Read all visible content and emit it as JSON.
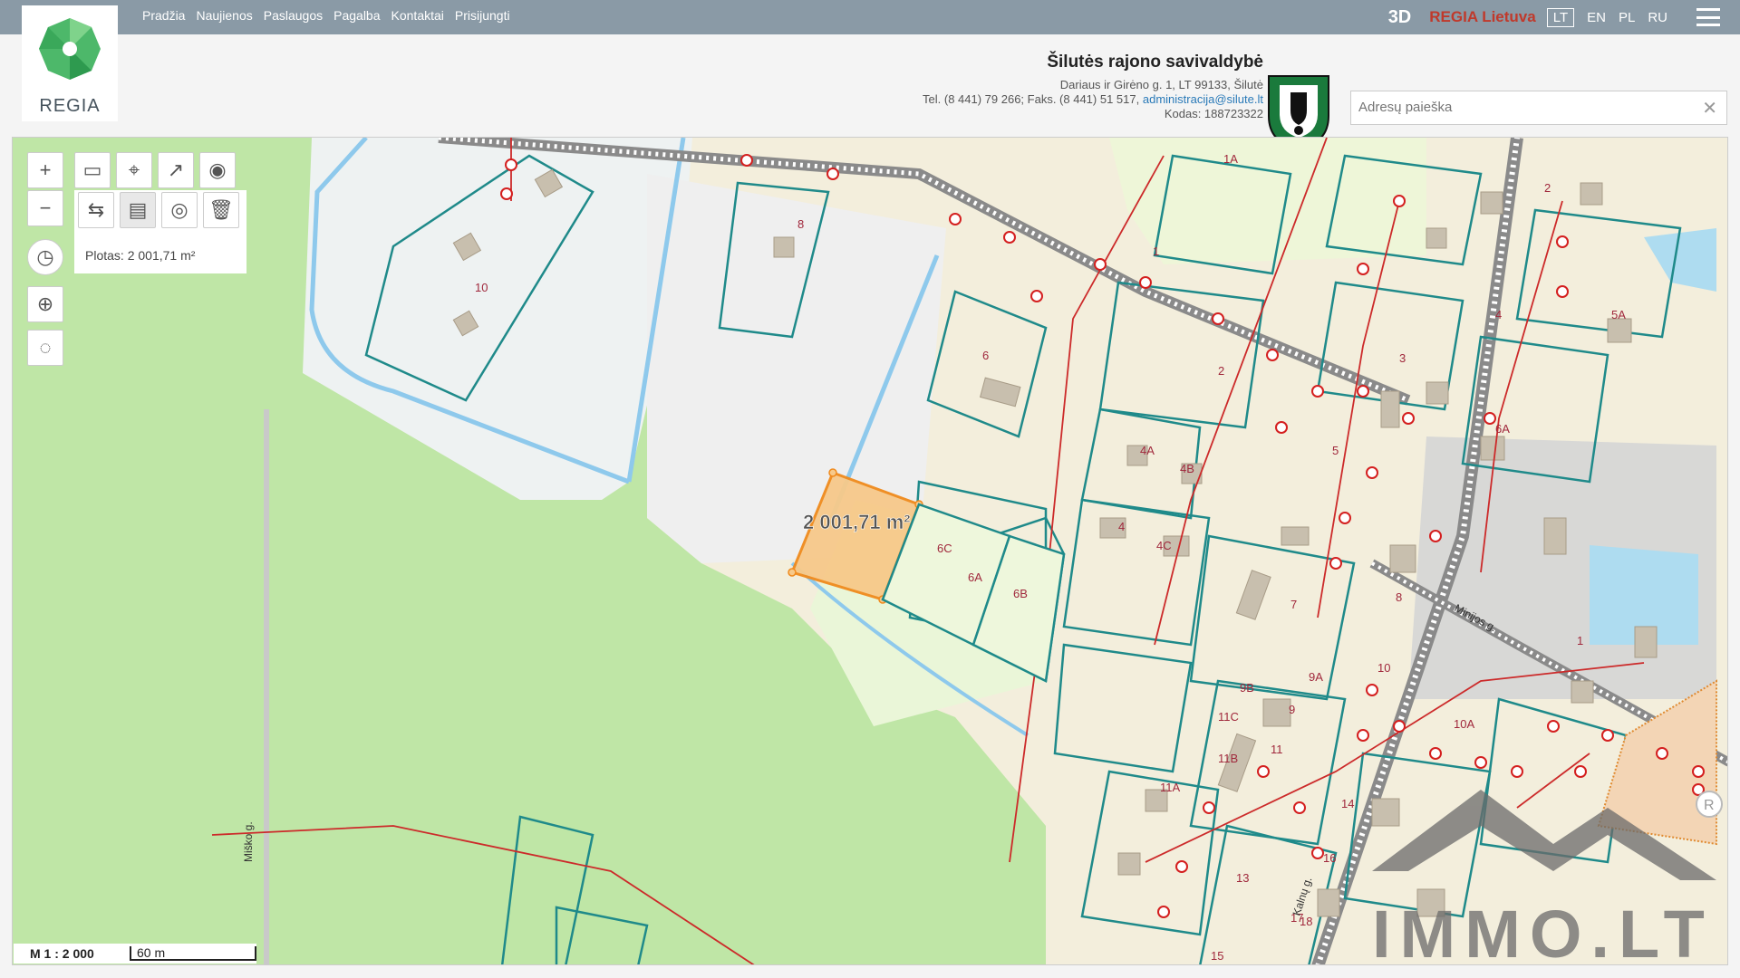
{
  "nav": {
    "items": [
      "Pradžia",
      "Naujienos",
      "Paslaugos",
      "Pagalba",
      "Kontaktai",
      "Prisijungti"
    ],
    "btn_3d": "3D",
    "brand": "REGIA Lietuva",
    "languages": [
      "LT",
      "EN",
      "PL",
      "RU"
    ],
    "active_language": "LT"
  },
  "logo": {
    "text": "REGIA"
  },
  "municipality": {
    "name": "Šilutės rajono savivaldybė",
    "address": "Dariaus ir Girėno g. 1, LT 99133, Šilutė",
    "phone": "Tel. (8 441) 79 266; Faks. (8 441) 51 517,",
    "email": "administracija@silute.lt",
    "code": "Kodas: 188723322"
  },
  "search": {
    "placeholder": "Adresų paieška",
    "value": ""
  },
  "measure": {
    "panel_text": "Plotas: 2 001,71 m²",
    "map_label": "2 001,71 m²"
  },
  "scale": {
    "ratio": "M 1 : 2 000",
    "length": "60 m"
  },
  "street_labels": {
    "misko": "Miško g.",
    "minijos": "Minijos g.",
    "kalnu": "Kalnų g."
  },
  "parcel_labels": [
    "1A",
    "1",
    "10",
    "8",
    "6",
    "6C",
    "6A",
    "6B",
    "5",
    "7",
    "8",
    "4",
    "4A",
    "4B",
    "4C",
    "2",
    "3",
    "2",
    "4",
    "5A",
    "6A",
    "9",
    "9A",
    "9B",
    "10",
    "10A",
    "11",
    "11A",
    "11B",
    "11C",
    "13",
    "14",
    "15",
    "16",
    "17",
    "18",
    "1"
  ],
  "watermark": {
    "text": "IMMO.LT"
  },
  "colors": {
    "topbar": "#8a9aa6",
    "accent_red": "#c0392b",
    "measure_fill": "#f7c98a",
    "measure_stroke": "#f08a1c",
    "parcel_line": "#1f8a8a",
    "grass": "#bfe6a6",
    "building": "#c8bfae"
  }
}
